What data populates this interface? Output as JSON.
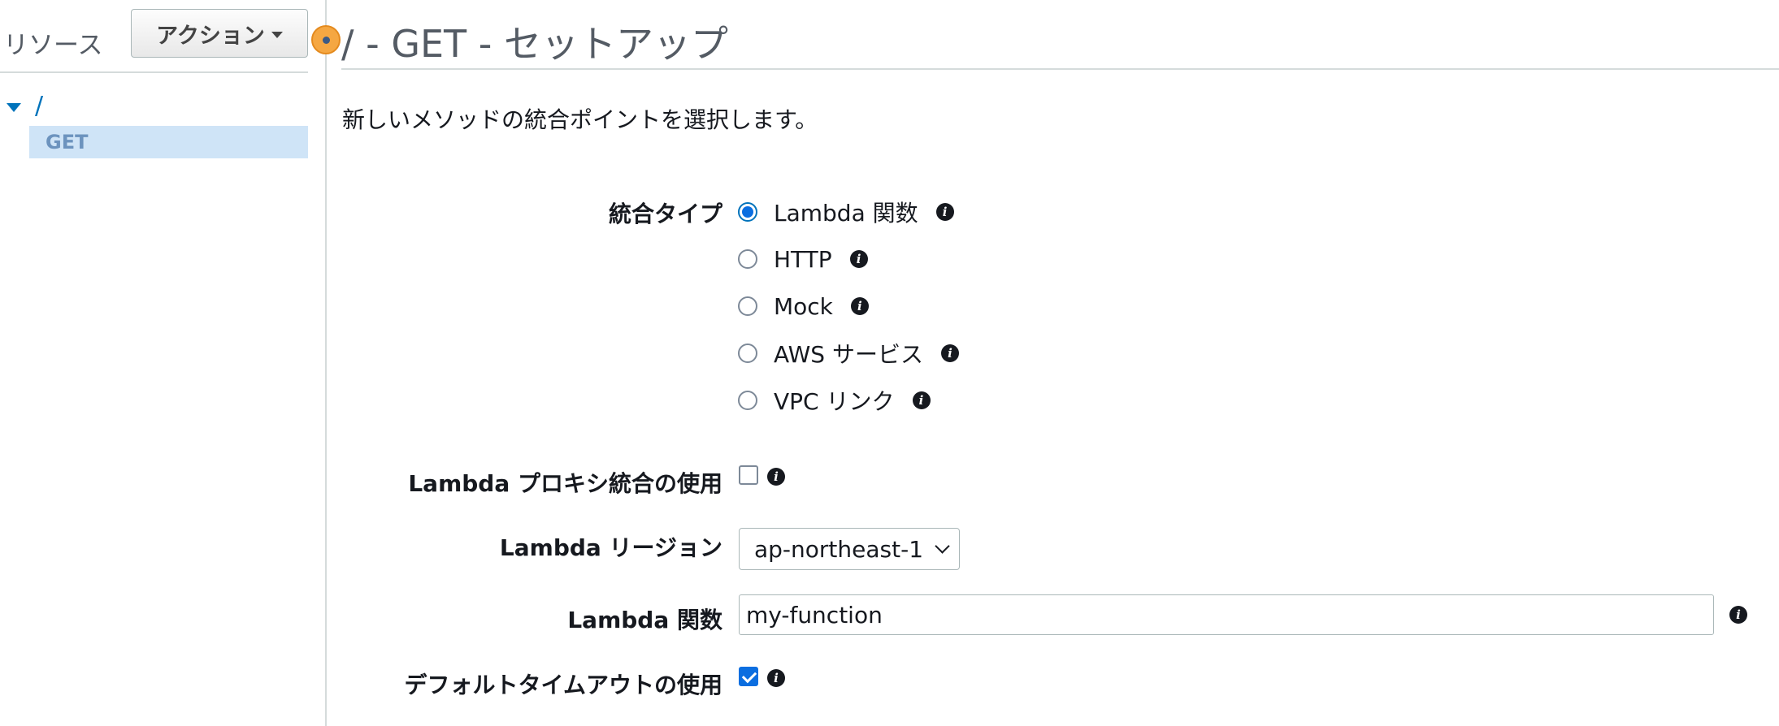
{
  "resources_panel": {
    "title": "リソース",
    "actions_label": "アクション",
    "tree": {
      "root": "/",
      "methods": [
        "GET"
      ]
    }
  },
  "page": {
    "title": "/ - GET - セットアップ",
    "description": "新しいメソッドの統合ポイントを選択します。"
  },
  "form": {
    "integration_type": {
      "label": "統合タイプ",
      "selected": "Lambda 関数",
      "options": [
        "Lambda 関数",
        "HTTP",
        "Mock",
        "AWS サービス",
        "VPC リンク"
      ]
    },
    "lambda_proxy": {
      "label": "Lambda プロキシ統合の使用",
      "checked": false
    },
    "lambda_region": {
      "label": "Lambda リージョン",
      "value": "ap-northeast-1"
    },
    "lambda_function": {
      "label": "Lambda 関数",
      "value": "my-function"
    },
    "default_timeout": {
      "label": "デフォルトタイムアウトの使用",
      "checked": true
    }
  },
  "colors": {
    "accent": "#0073bb",
    "selected_bg": "#cfe4f7",
    "handle": "#f5a742"
  }
}
